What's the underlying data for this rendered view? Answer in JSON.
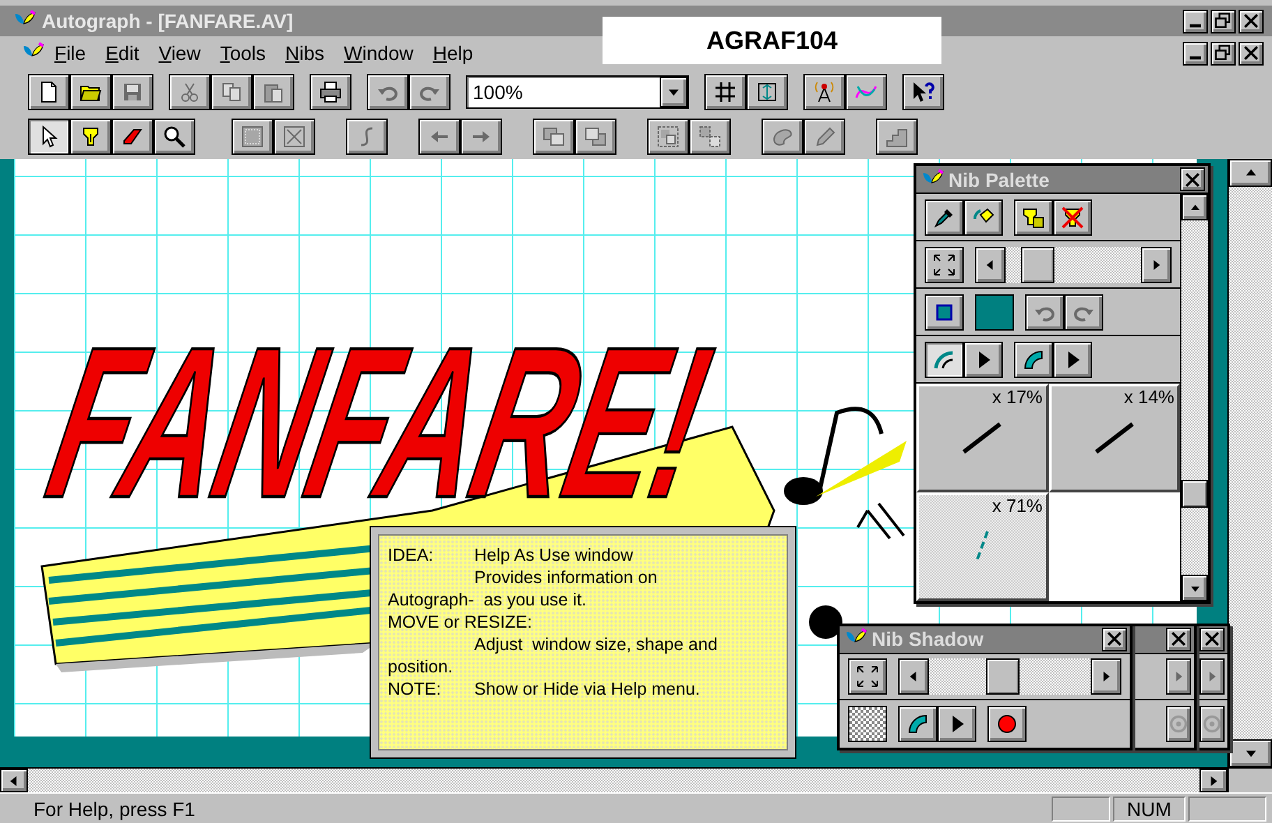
{
  "window": {
    "title": "Autograph - [FANFARE.AV]"
  },
  "caption_label": "AGRAF104",
  "menu": [
    "File",
    "Edit",
    "View",
    "Tools",
    "Nibs",
    "Window",
    "Help"
  ],
  "toolbar": {
    "items": [
      {
        "kind": "buttons",
        "buttons": [
          {
            "disabled": false
          },
          {
            "disabled": false
          },
          {
            "disabled": true
          }
        ]
      },
      {
        "kind": "buttons",
        "buttons": [
          {
            "disabled": true
          },
          {
            "disabled": true
          },
          {
            "disabled": true
          }
        ]
      },
      {
        "kind": "buttons",
        "buttons": [
          {
            "disabled": false
          }
        ]
      },
      {
        "kind": "buttons",
        "buttons": [
          {
            "disabled": true
          },
          {
            "disabled": true
          }
        ]
      },
      {
        "kind": "combo",
        "value": "100%"
      },
      {
        "kind": "buttons",
        "buttons": [
          {
            "disabled": false
          },
          {
            "disabled": false
          }
        ]
      },
      {
        "kind": "buttons",
        "buttons": [
          {
            "disabled": false
          },
          {
            "disabled": false
          }
        ]
      },
      {
        "kind": "buttons",
        "buttons": [
          {
            "disabled": false
          }
        ]
      }
    ]
  },
  "drawing_toolbar": {
    "groups": [
      [
        {
          "selected": true,
          "disabled": false
        },
        {
          "selected": false,
          "disabled": false
        },
        {
          "selected": false,
          "disabled": false
        },
        {
          "selected": false,
          "disabled": false
        }
      ],
      [
        {
          "selected": false,
          "disabled": true
        },
        {
          "selected": false,
          "disabled": true
        }
      ],
      [
        {
          "selected": false,
          "disabled": true
        }
      ],
      [
        {
          "selected": false,
          "disabled": true
        },
        {
          "selected": false,
          "disabled": true
        }
      ],
      [
        {
          "selected": false,
          "disabled": true
        },
        {
          "selected": false,
          "disabled": true
        }
      ],
      [
        {
          "selected": false,
          "disabled": true
        },
        {
          "selected": false,
          "disabled": true
        }
      ],
      [
        {
          "selected": false,
          "disabled": true
        },
        {
          "selected": false,
          "disabled": true
        }
      ],
      [
        {
          "selected": false,
          "disabled": true
        }
      ]
    ]
  },
  "artwork": {
    "title": "FANFARE!"
  },
  "help_window": {
    "lines": [
      {
        "kind": "labeled",
        "label": "IDEA:",
        "text": "Help As Use window"
      },
      {
        "kind": "indented",
        "text": "Provides information on"
      },
      {
        "kind": "plain",
        "text": "Autograph-  as you use it."
      },
      {
        "kind": "plain",
        "text": "MOVE or RESIZE:"
      },
      {
        "kind": "indented",
        "text": "Adjust  window size, shape and"
      },
      {
        "kind": "plain",
        "text": "position."
      },
      {
        "kind": "labeled",
        "label": "NOTE:",
        "text": "Show or Hide via Help menu."
      }
    ]
  },
  "nib_palette": {
    "title": "Nib Palette",
    "tools": [
      {
        "disabled": false
      },
      {
        "disabled": false
      },
      {
        "disabled": false
      },
      {
        "disabled": false
      }
    ],
    "size_slider": {
      "level": 0.15
    },
    "history": [
      {
        "disabled": true
      },
      {
        "disabled": true
      }
    ],
    "stroke_styles": [
      {
        "selected": true
      },
      {
        "selected": false
      }
    ],
    "nibs": [
      {
        "label": "x 17%",
        "kind": "solid"
      },
      {
        "label": "x 14%",
        "kind": "solid"
      },
      {
        "label": "x 71%",
        "kind": "faded"
      }
    ]
  },
  "nib_shadow": {
    "title": "Nib Shadow",
    "size_slider": {
      "level": 0.45
    },
    "windows_behind": [
      {
        "kind": "palette"
      },
      {
        "kind": "palette"
      }
    ]
  },
  "status_bar": {
    "text": "For Help, press F1",
    "num_indicator": "NUM"
  }
}
